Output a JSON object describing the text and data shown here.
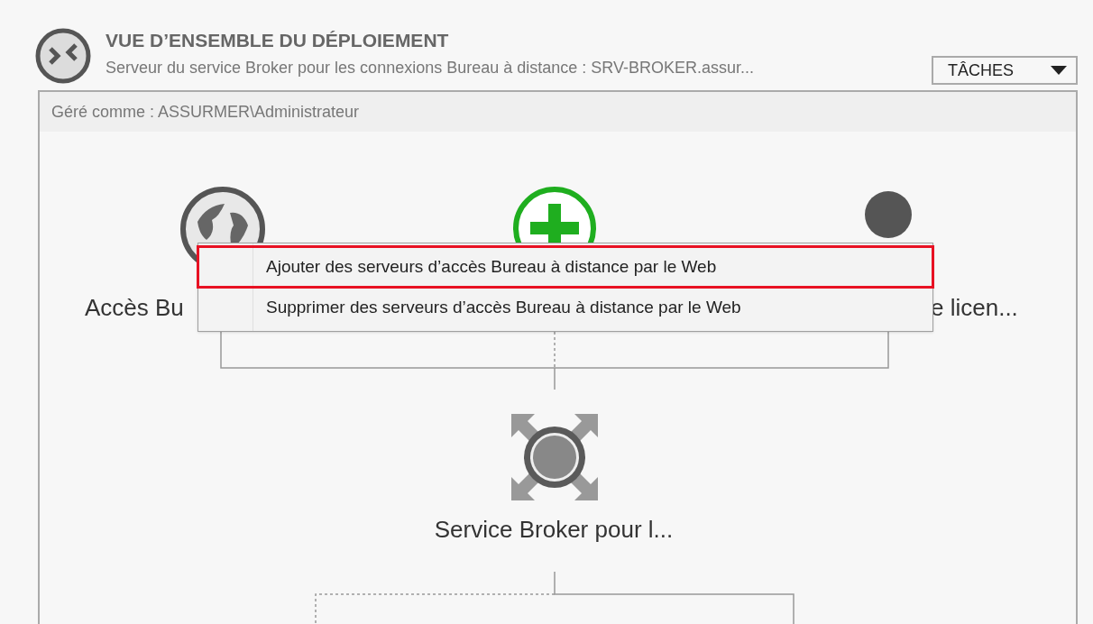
{
  "header": {
    "title": "VUE D’ENSEMBLE DU DÉPLOIEMENT",
    "subtitle": "Serveur du service Broker pour les connexions Bureau à distance : SRV-BROKER.assur...",
    "tasks_button": "TÂCHES"
  },
  "panel": {
    "managed_as": "Géré comme : ASSURMER\\Administrateur"
  },
  "nodes": [
    {
      "kind": "globe",
      "label": "Accès Bu"
    },
    {
      "kind": "add"
    },
    {
      "kind": "person",
      "label": "e licen..."
    },
    {
      "kind": "broker",
      "label": "Service Broker pour l..."
    }
  ],
  "context_menu": {
    "items": [
      {
        "label": "Ajouter des serveurs d’accès Bureau à distance par le Web",
        "highlighted": true
      },
      {
        "label": "Supprimer des serveurs d’accès Bureau à distance par le Web",
        "highlighted": false
      }
    ]
  }
}
